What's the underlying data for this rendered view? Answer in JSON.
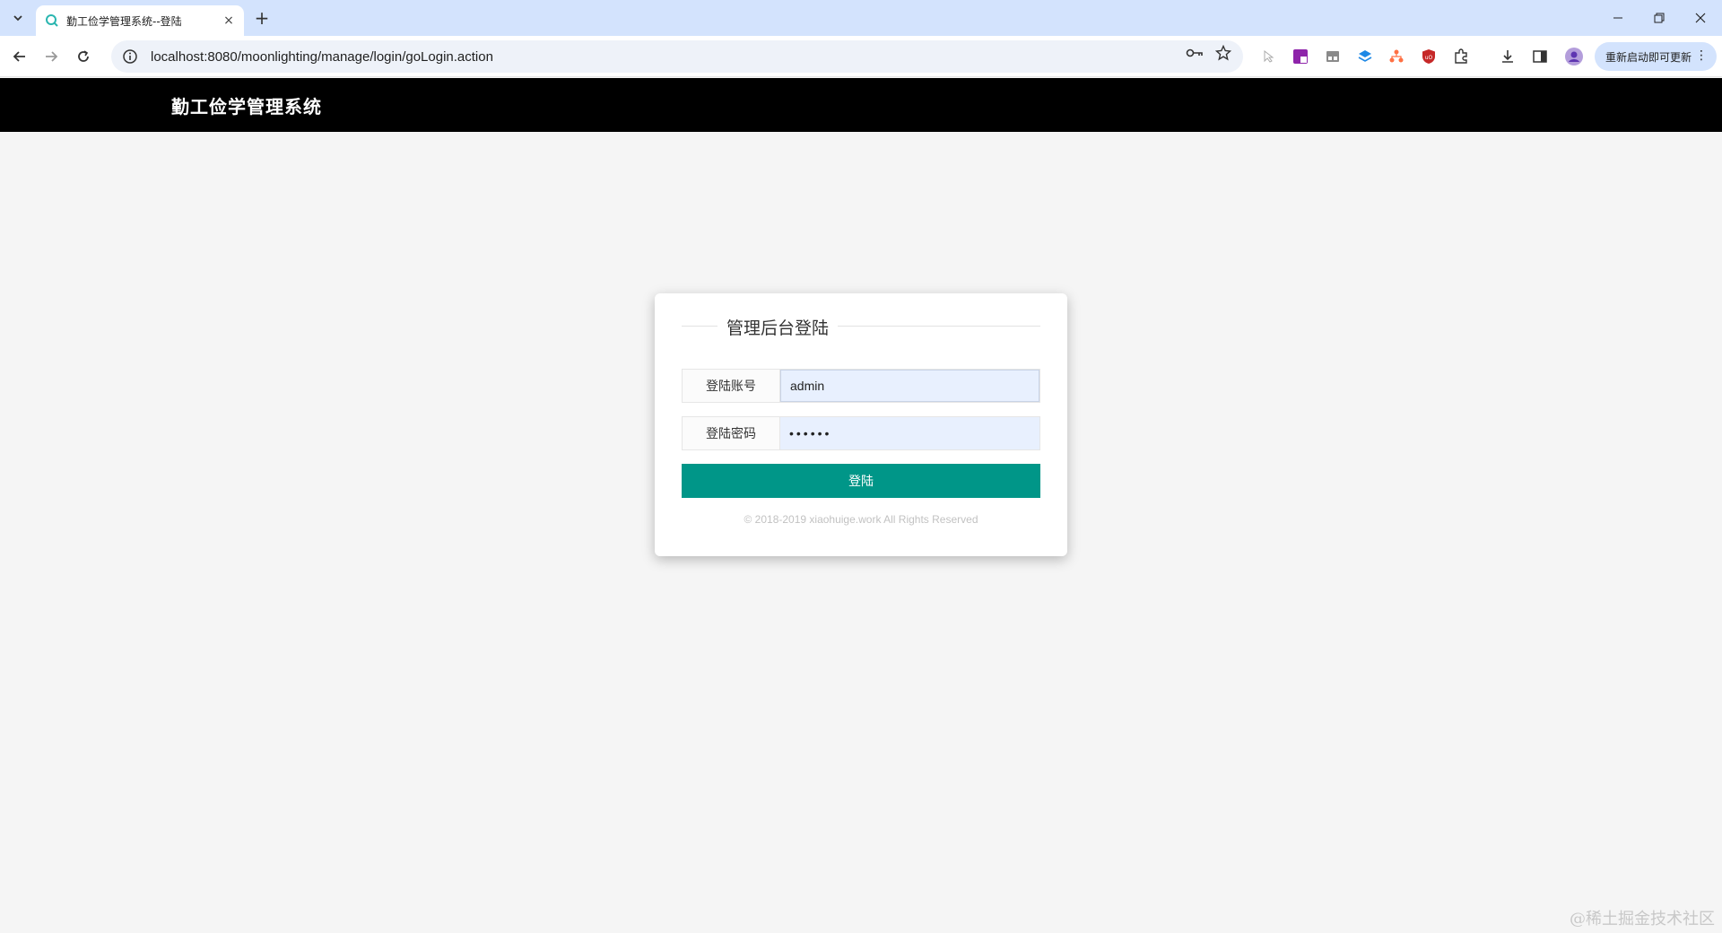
{
  "browser": {
    "tab_title": "勤工俭学管理系统--登陆",
    "tab_close": "×",
    "new_tab": "+",
    "url": "localhost:8080/moonlighting/manage/login/goLogin.action",
    "update_label": "重新启动即可更新",
    "update_menu": "⋮",
    "icons": [
      "tab-search-icon",
      "back-icon",
      "forward-icon",
      "reload-icon",
      "info-icon",
      "key-icon",
      "star-icon",
      "extensions-icon",
      "download-icon",
      "sidepanel-icon",
      "profile-icon"
    ]
  },
  "site": {
    "title": "勤工俭学管理系统"
  },
  "login": {
    "heading": "管理后台登陆",
    "account_label": "登陆账号",
    "account_value": "admin",
    "password_label": "登陆密码",
    "password_value": "••••••",
    "submit_label": "登陆",
    "copyright": "© 2018-2019 xiaohuige.work All Rights Reserved"
  },
  "watermark": "@稀土掘金技术社区",
  "colors": {
    "primary": "#009688",
    "header_bg": "#000000",
    "page_bg": "#f5f5f5",
    "tabstrip_bg": "#d3e3fd"
  }
}
